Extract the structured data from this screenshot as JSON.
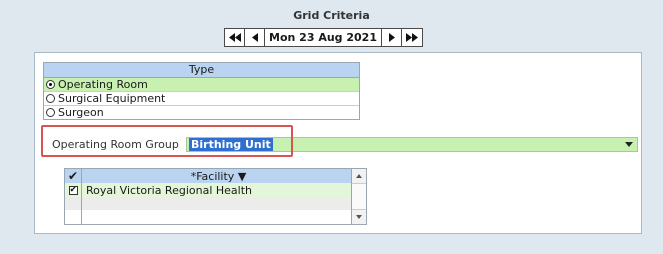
{
  "header": {
    "title": "Grid Criteria"
  },
  "date_nav": {
    "first_icon": "double-left-arrow-icon",
    "prev_icon": "left-arrow-icon",
    "date": "Mon 23 Aug 2021",
    "next_icon": "right-arrow-icon",
    "last_icon": "double-right-arrow-icon"
  },
  "type_table": {
    "header": "Type",
    "options": [
      {
        "label": "Operating Room",
        "selected": true
      },
      {
        "label": "Surgical Equipment",
        "selected": false
      },
      {
        "label": "Surgeon",
        "selected": false
      }
    ]
  },
  "or_group": {
    "label": "Operating Room Group",
    "value": "Birthing Unit"
  },
  "facility_grid": {
    "check_header": "✔",
    "column_header": "*Facility ▼",
    "rows": [
      {
        "checked": true,
        "name": "Royal Victoria Regional Health"
      },
      {
        "checked": false,
        "name": ""
      },
      {
        "checked": false,
        "name": ""
      }
    ]
  },
  "colors": {
    "background": "#dfe8ef",
    "header_blue": "#b9d3f0",
    "selected_green": "#c8f0b0",
    "highlight_blue": "#2f6fd0",
    "callout_red": "#d9534f"
  }
}
